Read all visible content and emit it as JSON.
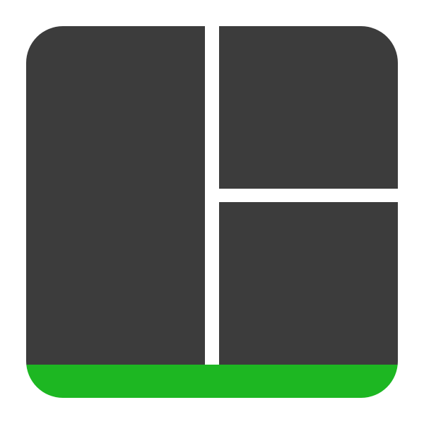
{
  "icon": {
    "name": "split-layout-icon",
    "colors": {
      "pane": "#3c3c3c",
      "divider": "#ffffff",
      "accent_bar": "#1db722",
      "background": "#ffffff"
    },
    "panes": [
      "left-pane",
      "top-right-pane",
      "bottom-right-pane"
    ]
  }
}
